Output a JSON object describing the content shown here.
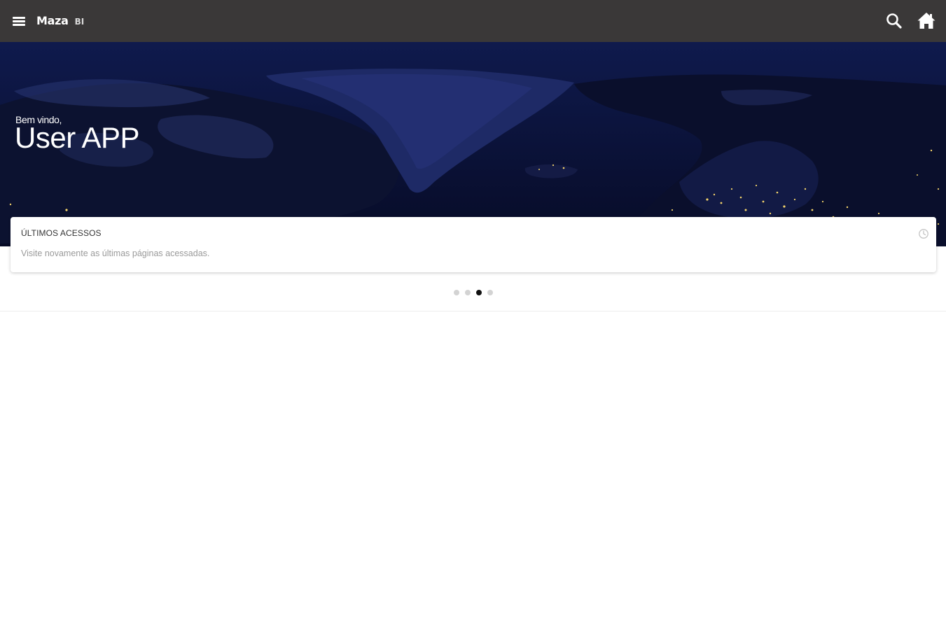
{
  "header": {
    "brand_name": "Maza",
    "brand_suffix": "BI",
    "icons": [
      "menu-icon",
      "search-icon",
      "home-icon"
    ],
    "background_color": "#3a3838"
  },
  "hero": {
    "welcome_text": "Bem vindo,",
    "user_name": "User APP",
    "background_color": "#0b1238"
  },
  "recent_access_card": {
    "title": "ÚLTIMOS ACESSOS",
    "description": "Visite novamente as últimas páginas acessadas.",
    "icon": "clock-icon"
  },
  "pager": {
    "total": 4,
    "active_index": 2
  }
}
